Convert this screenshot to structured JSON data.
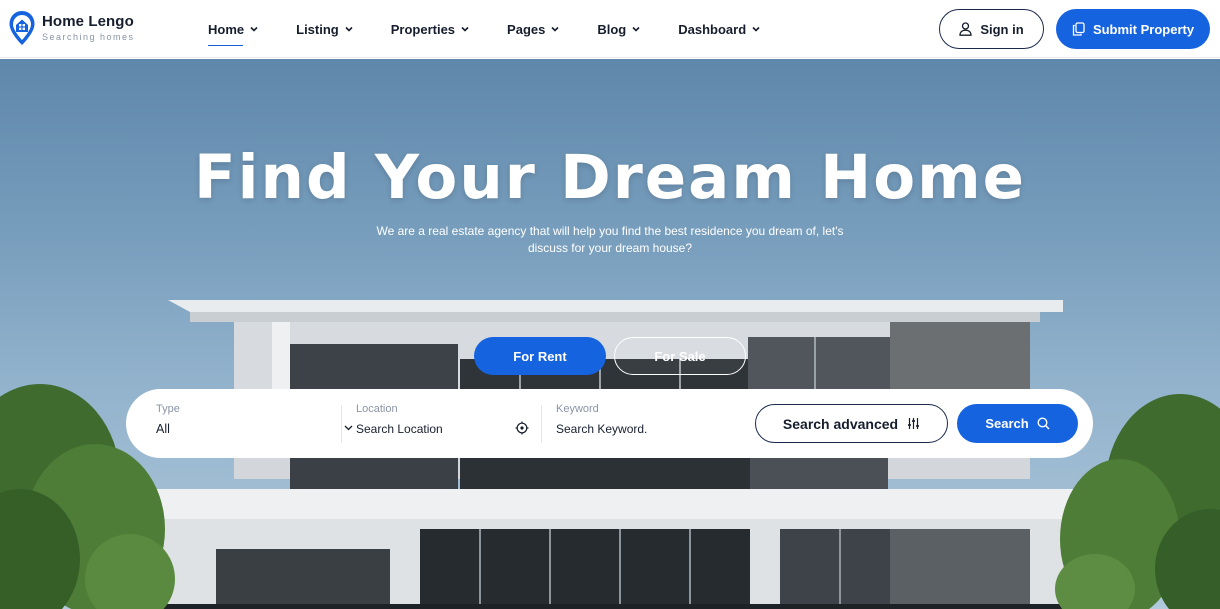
{
  "brand": {
    "name": "Home Lengo",
    "tagline": "Searching homes",
    "accent": "#1563df"
  },
  "nav": {
    "items": [
      {
        "label": "Home",
        "active": true
      },
      {
        "label": "Listing"
      },
      {
        "label": "Properties"
      },
      {
        "label": "Pages"
      },
      {
        "label": "Blog"
      },
      {
        "label": "Dashboard"
      }
    ]
  },
  "header": {
    "signin_label": "Sign in",
    "submit_label": "Submit Property"
  },
  "hero": {
    "title": "Find Your Dream Home",
    "subtitle": "We are a real estate agency that will help you find the best residence you dream of, let's discuss for your dream house?"
  },
  "tabs": {
    "rent": "For Rent",
    "sale": "For Sale"
  },
  "search": {
    "type_label": "Type",
    "type_value": "All",
    "location_label": "Location",
    "location_placeholder": "Search Location",
    "keyword_label": "Keyword",
    "keyword_placeholder": "Search Keyword.",
    "advanced_label": "Search advanced",
    "search_label": "Search"
  }
}
